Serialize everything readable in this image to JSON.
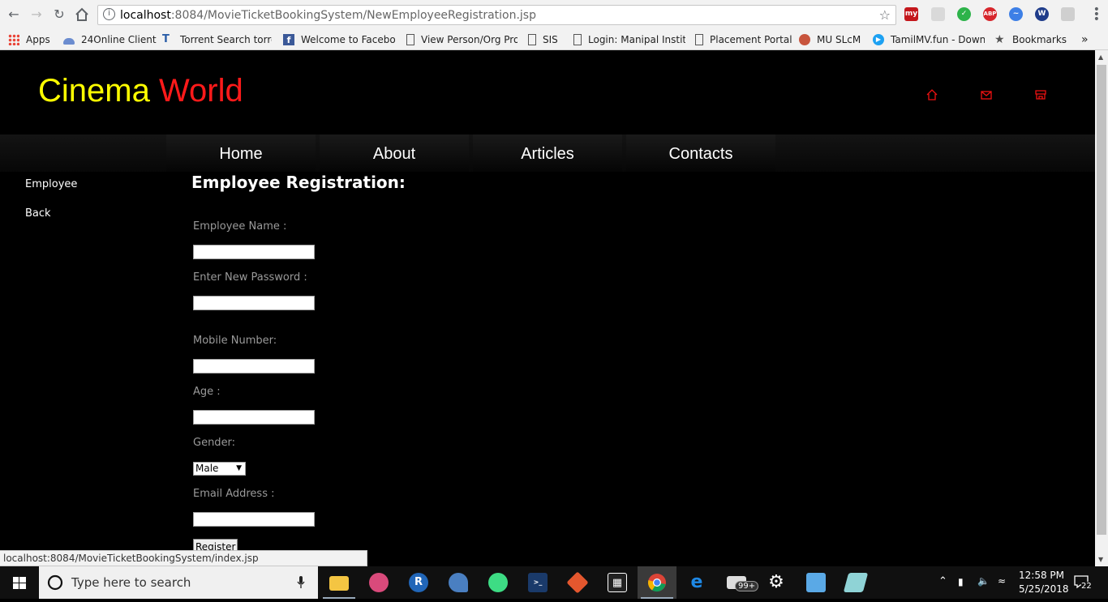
{
  "browser": {
    "url_host": "localhost",
    "url_rest": ":8084/MovieTicketBookingSystem/NewEmployeeRegistration.jsp",
    "bookmarks": [
      {
        "label": "Apps"
      },
      {
        "label": "24Online Client"
      },
      {
        "label": "Torrent Search torre"
      },
      {
        "label": "Welcome to Faceboo"
      },
      {
        "label": "View Person/Org Pro"
      },
      {
        "label": "SIS"
      },
      {
        "label": "Login: Manipal Instit"
      },
      {
        "label": "Placement Portal"
      },
      {
        "label": "MU SLcM"
      },
      {
        "label": "TamilMV.fun - Down"
      },
      {
        "label": "Bookmarks"
      }
    ],
    "overflow": "»",
    "extensions": [
      "my",
      "ABP",
      "W"
    ],
    "status_url": "localhost:8084/MovieTicketBookingSystem/index.jsp"
  },
  "site": {
    "logo_word1": "Cinema",
    "logo_word2": "World",
    "logo_color1": "#ffff00",
    "logo_color2": "#ff1a1a",
    "top_icons": [
      "home-icon",
      "mail-icon",
      "store-icon"
    ],
    "menu": [
      "Home",
      "About",
      "Articles",
      "Contacts"
    ],
    "sidebar": [
      "Employee",
      "Back"
    ]
  },
  "form": {
    "heading": "Employee Registration:",
    "name_label": "Employee Name :",
    "password_label": "Enter New Password :",
    "mobile_label": "Mobile Number:",
    "age_label": "Age :",
    "gender_label": "Gender:",
    "gender_value": "Male",
    "email_label": "Email Address :",
    "submit_label": "Register"
  },
  "taskbar": {
    "search_placeholder": "Type here to search",
    "mail_badge": "99+",
    "time": "12:58 PM",
    "date": "5/25/2018",
    "notifications": "22"
  }
}
